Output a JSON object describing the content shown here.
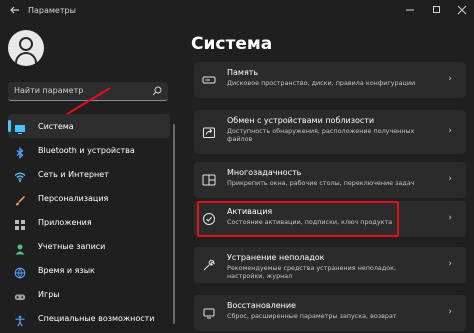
{
  "window": {
    "title": "Параметры",
    "back_icon": "back-arrow-icon",
    "controls": [
      "minimize",
      "maximize",
      "close"
    ]
  },
  "search": {
    "placeholder": "Найти параметр",
    "icon": "search-icon"
  },
  "sidebar": {
    "items": [
      {
        "label": "Система",
        "icon": "system-display-icon",
        "active": true
      },
      {
        "label": "Bluetooth и устройства",
        "icon": "bluetooth-icon"
      },
      {
        "label": "Сеть и Интернет",
        "icon": "wifi-icon"
      },
      {
        "label": "Персонализация",
        "icon": "brush-icon"
      },
      {
        "label": "Приложения",
        "icon": "apps-icon"
      },
      {
        "label": "Учетные записи",
        "icon": "account-icon"
      },
      {
        "label": "Время и язык",
        "icon": "globe-icon"
      },
      {
        "label": "Игры",
        "icon": "gamepad-icon"
      },
      {
        "label": "Специальные возможности",
        "icon": "accessibility-icon"
      }
    ]
  },
  "main": {
    "title": "Система",
    "cards": [
      {
        "title": "Память",
        "desc": "Дисковое пространство, диски, правила конфигурации",
        "icon": "storage-icon"
      },
      {
        "title": "Обмен с устройствами поблизости",
        "desc": "Доступность обнаружения, расположение полученных файлов",
        "icon": "share-icon"
      },
      {
        "title": "Многозадачность",
        "desc": "Прикрепить окна, рабочие столы, переключение задач",
        "icon": "multitask-icon"
      },
      {
        "title": "Активация",
        "desc": "Состояние активации, подписки, ключ продукта",
        "icon": "check-circle-icon",
        "highlighted": true
      },
      {
        "title": "Устранение неполадок",
        "desc": "Рекомендуемые средства устранения неполадок, настройки, журнал",
        "icon": "wrench-icon"
      },
      {
        "title": "Восстановление",
        "desc": "Сброс, расширенные параметры запуска, возврат",
        "icon": "recovery-icon"
      }
    ]
  },
  "colors": {
    "background": "#1f1f1f",
    "card": "#2b2b2b",
    "accent": "#4cc2ff",
    "highlight": "#e0101a"
  }
}
